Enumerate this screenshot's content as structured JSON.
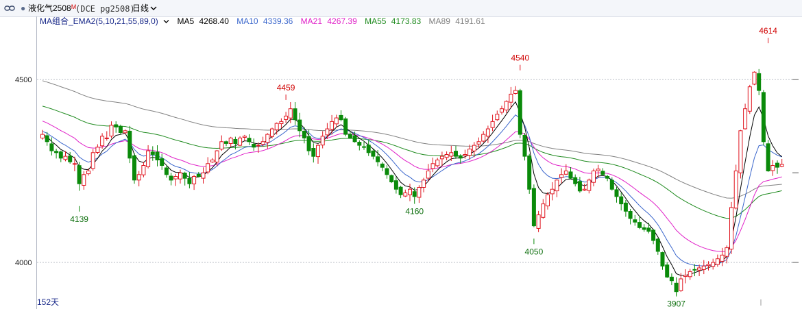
{
  "header": {
    "instrument": "液化气2508",
    "instrument_mark": "M",
    "code": "(DCE pg2508)",
    "period": "日线",
    "period_chevron_icon": "chevron-down-icon",
    "link_icon": "link-icon",
    "dot_icon": "bullet-icon"
  },
  "legend": {
    "group_label": "MA组合_EMA2(5,10,21,55,89,0)",
    "items": [
      {
        "label": "MA5",
        "value": "4268.40",
        "color": "#000000"
      },
      {
        "label": "MA10",
        "value": "4339.36",
        "color": "#3a66cc"
      },
      {
        "label": "MA21",
        "value": "4267.39",
        "color": "#e020c8"
      },
      {
        "label": "MA55",
        "value": "4173.83",
        "color": "#1e8a1e"
      },
      {
        "label": "MA89",
        "value": "4191.61",
        "color": "#808080"
      }
    ]
  },
  "footer": {
    "days_label": "152天"
  },
  "chart_data": {
    "type": "candlestick",
    "y_ticks": [
      4000,
      4500
    ],
    "ylim": [
      3880,
      4650
    ],
    "up_color": "#e0141e",
    "down_color": "#0a8a0a",
    "annotations": [
      {
        "text": "4139",
        "value": 4139,
        "kind": "low",
        "index": 8
      },
      {
        "text": "4459",
        "value": 4459,
        "kind": "high",
        "index": 53
      },
      {
        "text": "4160",
        "value": 4160,
        "kind": "low",
        "index": 81
      },
      {
        "text": "4540",
        "value": 4540,
        "kind": "high",
        "index": 104
      },
      {
        "text": "4050",
        "value": 4050,
        "kind": "low",
        "index": 107
      },
      {
        "text": "3907",
        "value": 3907,
        "kind": "low",
        "index": 138
      },
      {
        "text": "4614",
        "value": 4614,
        "kind": "high",
        "index": 158
      }
    ],
    "close": [
      4350,
      4330,
      4305,
      4300,
      4285,
      4290,
      4275,
      4270,
      4215,
      4240,
      4250,
      4300,
      4315,
      4345,
      4340,
      4375,
      4370,
      4355,
      4360,
      4285,
      4225,
      4240,
      4265,
      4305,
      4295,
      4280,
      4265,
      4240,
      4225,
      4235,
      4245,
      4230,
      4215,
      4235,
      4235,
      4245,
      4270,
      4280,
      4305,
      4330,
      4325,
      4340,
      4325,
      4340,
      4345,
      4330,
      4315,
      4320,
      4330,
      4350,
      4365,
      4380,
      4385,
      4400,
      4420,
      4390,
      4360,
      4340,
      4305,
      4290,
      4320,
      4345,
      4365,
      4385,
      4395,
      4390,
      4350,
      4340,
      4330,
      4320,
      4315,
      4300,
      4290,
      4275,
      4260,
      4240,
      4220,
      4200,
      4185,
      4190,
      4200,
      4180,
      4205,
      4225,
      4250,
      4270,
      4280,
      4290,
      4295,
      4300,
      4290,
      4285,
      4295,
      4310,
      4320,
      4330,
      4350,
      4365,
      4385,
      4405,
      4420,
      4440,
      4460,
      4470,
      4350,
      4290,
      4200,
      4100,
      4130,
      4160,
      4185,
      4200,
      4225,
      4240,
      4250,
      4230,
      4215,
      4195,
      4200,
      4225,
      4250,
      4255,
      4240,
      4230,
      4200,
      4180,
      4160,
      4140,
      4120,
      4110,
      4095,
      4090,
      4085,
      4060,
      4030,
      3990,
      3960,
      3950,
      3920,
      3955,
      3965,
      3975,
      3980,
      3985,
      3990,
      3995,
      4000,
      4010,
      4020,
      4040,
      4150,
      4250,
      4360,
      4420,
      4480,
      4520,
      4470,
      4330,
      4250,
      4265,
      4260,
      4268
    ]
  }
}
